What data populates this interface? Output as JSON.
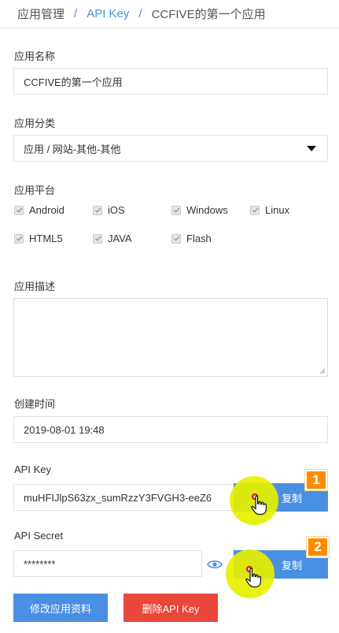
{
  "breadcrumb": {
    "root": "应用管理",
    "middle": "API Key",
    "current": "CCFIVE的第一个应用",
    "separator": "/"
  },
  "app_name": {
    "label": "应用名称",
    "value": "CCFIVE的第一个应用"
  },
  "app_category": {
    "label": "应用分类",
    "value": "应用 / 网站-其他-其他"
  },
  "app_platform": {
    "label": "应用平台",
    "options": [
      "Android",
      "iOS",
      "Windows",
      "Linux",
      "HTML5",
      "JAVA",
      "Flash"
    ]
  },
  "app_description": {
    "label": "应用描述",
    "value": ""
  },
  "created_time": {
    "label": "创建时间",
    "value": "2019-08-01 19:48"
  },
  "api_key": {
    "label": "API Key",
    "value": "muHFIJlpS63zx_sumRzzY3FVGH3-eeZ6",
    "copy_label": "复制"
  },
  "api_secret": {
    "label": "API Secret",
    "value": "********",
    "copy_label": "复制"
  },
  "actions": {
    "edit_label": "修改应用资料",
    "delete_label": "删除API Key"
  },
  "step_badges": [
    "1",
    "2"
  ],
  "colors": {
    "link": "#4a90e2",
    "primary": "#4a90e2",
    "danger": "#e8473a",
    "badge": "#ff8a00",
    "highlight": "#e6f000"
  }
}
